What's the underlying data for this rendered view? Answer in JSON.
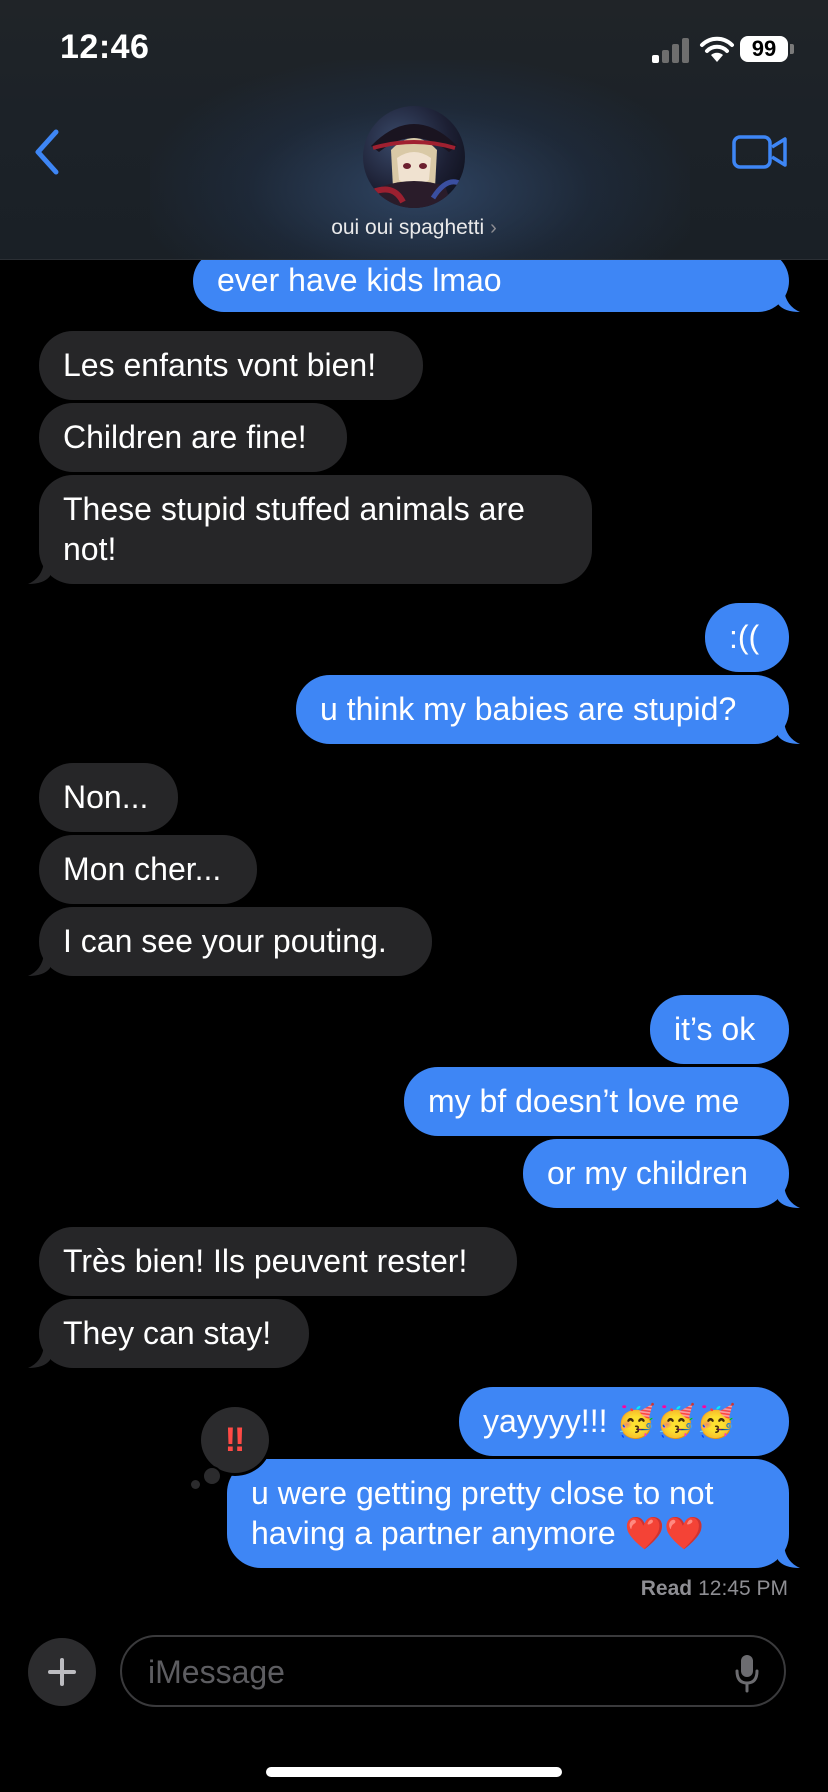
{
  "status_bar": {
    "time": "12:46",
    "battery": "99"
  },
  "header": {
    "contact_name": "oui oui spaghetti",
    "chevron": "›"
  },
  "messages": [
    {
      "text": "ever have kids lmao",
      "from": "me"
    },
    {
      "text": "Les enfants vont bien!",
      "from": "them"
    },
    {
      "text": "Children are fine!",
      "from": "them"
    },
    {
      "text": "These stupid stuffed animals are not!",
      "from": "them"
    },
    {
      "text": ":((",
      "from": "me"
    },
    {
      "text": "u think my babies are stupid?",
      "from": "me"
    },
    {
      "text": "Non...",
      "from": "them"
    },
    {
      "text": "Mon cher...",
      "from": "them"
    },
    {
      "text": "I can see your pouting.",
      "from": "them"
    },
    {
      "text": "it’s ok",
      "from": "me"
    },
    {
      "text": "my bf doesn’t love me",
      "from": "me"
    },
    {
      "text": "or my children",
      "from": "me"
    },
    {
      "text": "Très bien! Ils peuvent rester!",
      "from": "them"
    },
    {
      "text": "They can stay!",
      "from": "them"
    },
    {
      "text": "yayyyy!!! 🥳🥳🥳",
      "from": "me"
    },
    {
      "text": "u were getting pretty close to not having a partner anymore ❤️❤️",
      "from": "me"
    }
  ],
  "reaction": {
    "symbol": "‼",
    "icon": "double-exclamation-icon"
  },
  "receipt": {
    "label": "Read",
    "time": "12:45 PM"
  },
  "composer": {
    "placeholder": "iMessage"
  },
  "colors": {
    "outgoing": "#3e86f5",
    "incoming": "#262628",
    "accent": "#3e86f5"
  }
}
